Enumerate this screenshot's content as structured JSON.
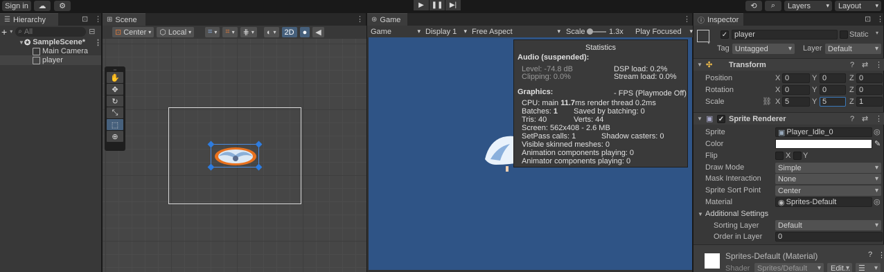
{
  "toolbar": {
    "sign_in": "Sign in",
    "layers": "Layers",
    "layout": "Layout"
  },
  "hierarchy": {
    "tab": "Hierarchy",
    "search_placeholder": "All",
    "items": [
      {
        "label": "SampleScene*"
      },
      {
        "label": "Main Camera"
      },
      {
        "label": "player"
      }
    ]
  },
  "scene": {
    "tab": "Scene",
    "center": "Center",
    "local": "Local",
    "mode_2d": "2D"
  },
  "game": {
    "tab": "Game",
    "game_dropdown": "Game",
    "display": "Display 1",
    "aspect": "Free Aspect",
    "scale_label": "Scale",
    "scale_value": "1.3x",
    "play_focused": "Play Focused"
  },
  "stats": {
    "title": "Statistics",
    "audio_header": "Audio (suspended):",
    "level": "Level: -74.8 dB",
    "clipping": "Clipping: 0.0%",
    "dsp": "DSP load: 0.2%",
    "stream": "Stream load: 0.0%",
    "graphics_header": "Graphics:",
    "fps": "- FPS (Playmode Off)",
    "cpu_prefix": "CPU: main ",
    "cpu_main": "11.7",
    "cpu_suffix": "ms  render thread 0.2ms",
    "batches_prefix": "Batches: ",
    "batches": "1",
    "saved_batching": "Saved by batching: 0",
    "tris": "Tris: 40",
    "verts": "Verts: 44",
    "screen": "Screen: 562x408 - 2.6 MB",
    "setpass": "SetPass calls: 1",
    "shadow": "Shadow casters: 0",
    "skinned": "Visible skinned meshes: 0",
    "anim_comp": "Animation components playing: 0",
    "animator_comp": "Animator components playing: 0"
  },
  "inspector": {
    "tab": "Inspector",
    "object_name": "player",
    "static_label": "Static",
    "tag_label": "Tag",
    "tag_value": "Untagged",
    "layer_label": "Layer",
    "layer_value": "Default",
    "transform": {
      "title": "Transform",
      "position_label": "Position",
      "rotation_label": "Rotation",
      "scale_label": "Scale",
      "position": {
        "x": "0",
        "y": "0",
        "z": "0"
      },
      "rotation": {
        "x": "0",
        "y": "0",
        "z": "0"
      },
      "scale": {
        "x": "5",
        "y": "5",
        "z": "1"
      }
    },
    "sprite_renderer": {
      "title": "Sprite Renderer",
      "sprite_label": "Sprite",
      "sprite_value": "Player_Idle_0",
      "color_label": "Color",
      "flip_label": "Flip",
      "flip_x": "X",
      "flip_y": "Y",
      "draw_mode_label": "Draw Mode",
      "draw_mode_value": "Simple",
      "mask_label": "Mask Interaction",
      "mask_value": "None",
      "sort_point_label": "Sprite Sort Point",
      "sort_point_value": "Center",
      "material_label": "Material",
      "material_value": "Sprites-Default",
      "additional": "Additional Settings",
      "sorting_layer_label": "Sorting Layer",
      "sorting_layer_value": "Default",
      "order_label": "Order in Layer",
      "order_value": "0"
    },
    "material": {
      "title": "Sprites-Default (Material)",
      "shader_label": "Shader",
      "shader_value": "Sprites/Default",
      "edit": "Edit..."
    }
  },
  "colors": {
    "accent_blue": "#46607c",
    "game_bg": "#2f5486",
    "sprite_orange": "#e8711e"
  }
}
